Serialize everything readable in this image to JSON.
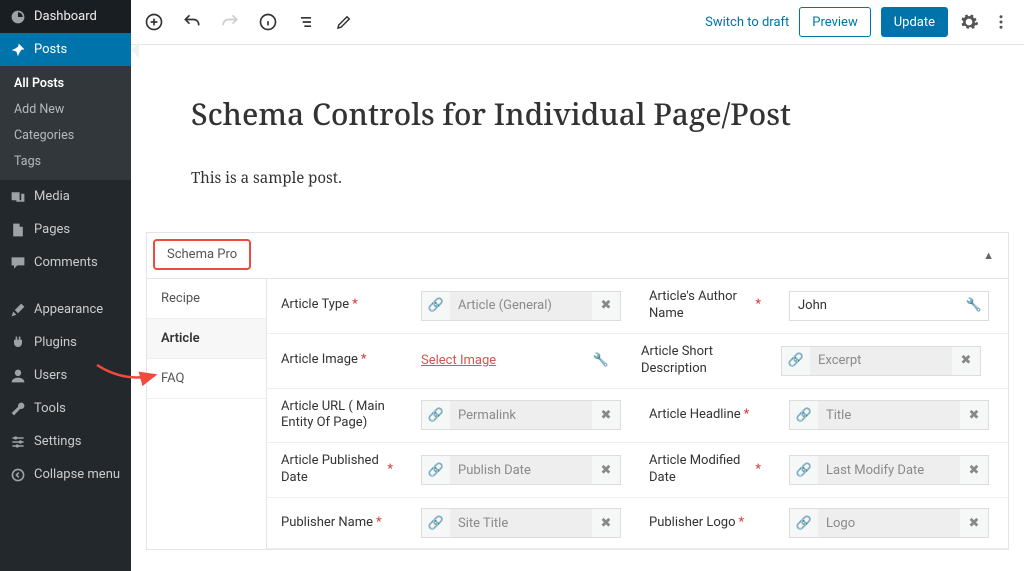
{
  "sidebar": {
    "dashboard": "Dashboard",
    "items": [
      {
        "label": "Posts"
      },
      {
        "label": "Media"
      },
      {
        "label": "Pages"
      },
      {
        "label": "Comments"
      },
      {
        "label": "Appearance"
      },
      {
        "label": "Plugins"
      },
      {
        "label": "Users"
      },
      {
        "label": "Tools"
      },
      {
        "label": "Settings"
      }
    ],
    "posts_submenu": [
      "All Posts",
      "Add New",
      "Categories",
      "Tags"
    ],
    "collapse": "Collapse menu"
  },
  "topbar": {
    "switch_draft": "Switch to draft",
    "preview": "Preview",
    "update": "Update"
  },
  "post": {
    "title": "Schema Controls for Individual Page/Post",
    "body": "This is a sample post."
  },
  "metabox": {
    "title": "Schema Pro",
    "tabs": [
      "Recipe",
      "Article",
      "FAQ"
    ],
    "fields": {
      "article_type": {
        "label": "Article Type",
        "value_placeholder": "Article (General)"
      },
      "author_name": {
        "label": "Article's Author Name",
        "value": "John"
      },
      "article_image": {
        "label": "Article Image",
        "action": "Select Image"
      },
      "short_desc": {
        "label": "Article Short Description",
        "value_placeholder": "Excerpt"
      },
      "article_url": {
        "label": "Article URL ( Main Entity Of Page)",
        "value_placeholder": "Permalink"
      },
      "headline": {
        "label": "Article Headline",
        "value_placeholder": "Title"
      },
      "published": {
        "label": "Article Published Date",
        "value_placeholder": "Publish Date"
      },
      "modified": {
        "label": "Article Modified Date",
        "value_placeholder": "Last Modify Date"
      },
      "publisher_name": {
        "label": "Publisher Name",
        "value_placeholder": "Site Title"
      },
      "publisher_logo": {
        "label": "Publisher Logo",
        "value_placeholder": "Logo"
      }
    }
  }
}
